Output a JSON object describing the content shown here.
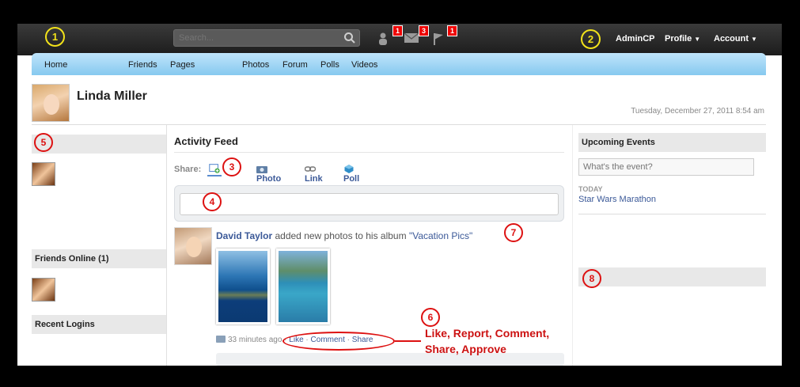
{
  "topbar": {
    "search_placeholder": "Search...",
    "notifications": [
      {
        "icon": "friend-request-icon",
        "count": "1"
      },
      {
        "icon": "mail-icon",
        "count": "3"
      },
      {
        "icon": "flag-icon",
        "count": "1"
      }
    ],
    "links": {
      "admincp": "AdminCP",
      "profile": "Profile",
      "account": "Account",
      "caret": "▼"
    }
  },
  "nav": {
    "items": [
      "Home",
      "Friends",
      "Pages",
      "Photos",
      "Forum",
      "Polls",
      "Videos"
    ]
  },
  "profile": {
    "name": "Linda Miller",
    "date": "Tuesday, December 27, 2011 8:54 am"
  },
  "left": {
    "friends_online_header": "Friends Online (1)",
    "recent_logins_header": "Recent Logins"
  },
  "feed": {
    "title": "Activity Feed",
    "share_label": "Share:",
    "share_options": [
      "Photo",
      "Link",
      "Poll"
    ],
    "story": {
      "author": "David Taylor",
      "action": "added new photos to his album",
      "album": "\"Vacation Pics\""
    },
    "time": "33 minutes ago",
    "actions": [
      "Like",
      "Comment",
      "Share"
    ]
  },
  "right": {
    "events_header": "Upcoming Events",
    "event_placeholder": "What's the event?",
    "today_label": "TODAY",
    "event_title": "Star Wars Marathon"
  },
  "annotations": {
    "numbers": [
      "1",
      "2",
      "3",
      "4",
      "5",
      "6",
      "7",
      "8"
    ],
    "note": "Like, Report, Comment, Share, Approve"
  },
  "colors": {
    "link": "#3b5998",
    "nav_top": "#bfe5fb",
    "nav_bottom": "#86c9ef",
    "annotation_red": "#d11111",
    "annotation_yellow": "#f2e21a"
  }
}
